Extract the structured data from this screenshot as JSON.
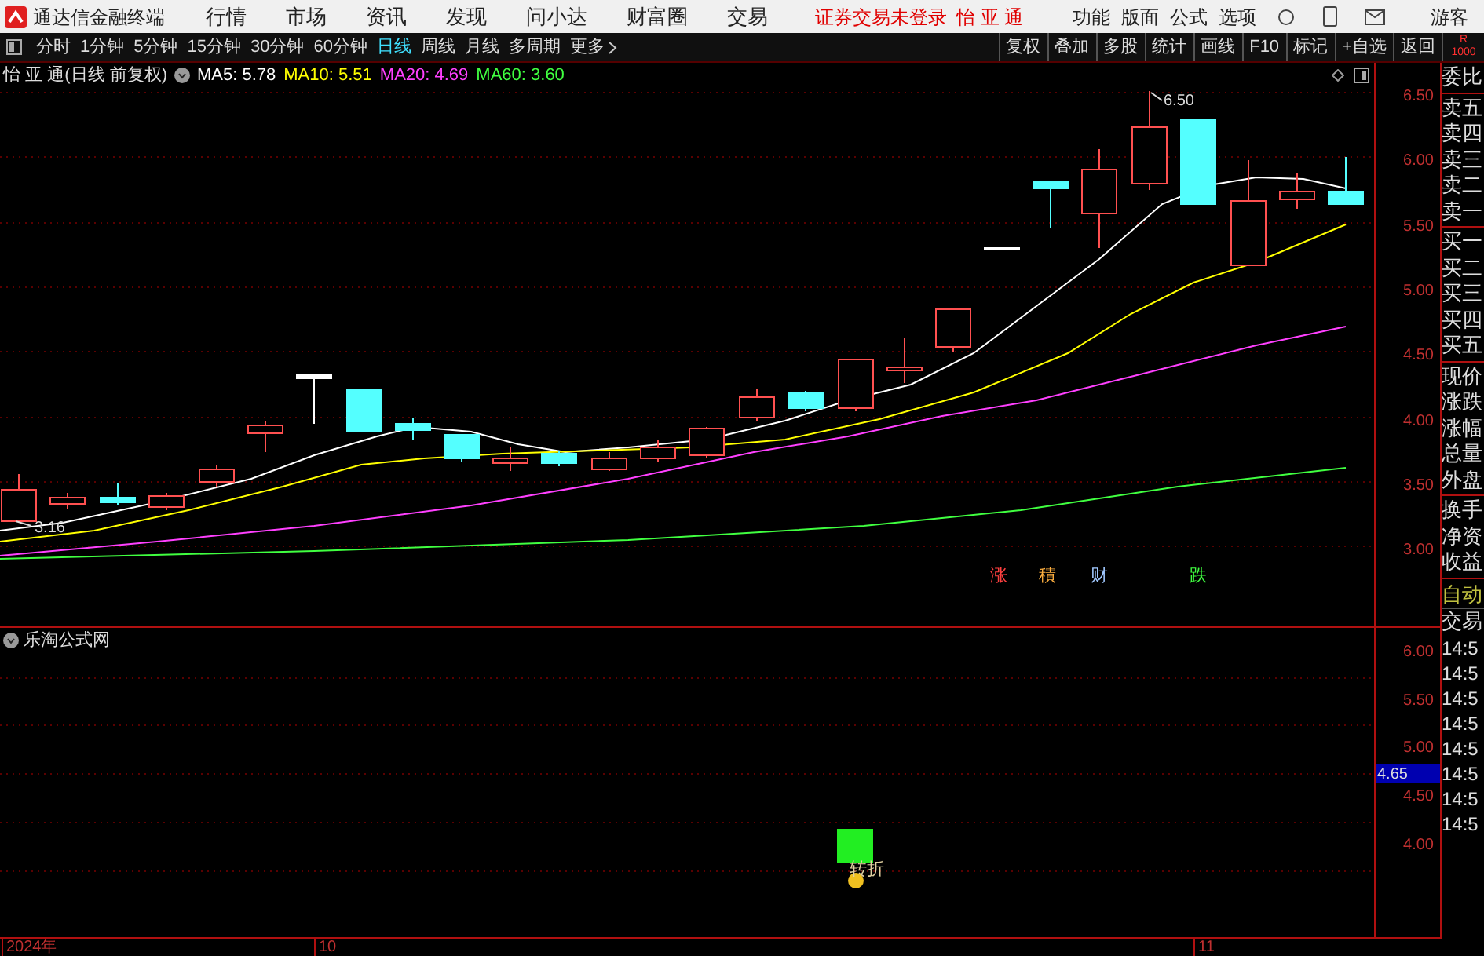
{
  "app": {
    "title": "通达信金融终端"
  },
  "menu": [
    "行情",
    "市场",
    "资讯",
    "发现",
    "问小达",
    "财富圈",
    "交易"
  ],
  "login_status": "证券交易未登录",
  "stock_name": "怡 亚 通",
  "right_menu": [
    "功能",
    "版面",
    "公式",
    "选项"
  ],
  "user": "游客",
  "periods": [
    {
      "label": "分时",
      "selected": false
    },
    {
      "label": "1分钟",
      "selected": false
    },
    {
      "label": "5分钟",
      "selected": false
    },
    {
      "label": "15分钟",
      "selected": false
    },
    {
      "label": "30分钟",
      "selected": false
    },
    {
      "label": "60分钟",
      "selected": false
    },
    {
      "label": "日线",
      "selected": true
    },
    {
      "label": "周线",
      "selected": false
    },
    {
      "label": "月线",
      "selected": false
    },
    {
      "label": "多周期",
      "selected": false
    },
    {
      "label": "更多",
      "selected": false
    }
  ],
  "tools": [
    "复权",
    "叠加",
    "多股",
    "统计",
    "画线",
    "F10",
    "标记",
    "+自选",
    "返回"
  ],
  "corner": [
    "R",
    "1000"
  ],
  "main_chart": {
    "title": "怡 亚 通(日线 前复权)",
    "ma": [
      {
        "label": "MA5: 5.78",
        "color": "#ffffff"
      },
      {
        "label": "MA10: 5.51",
        "color": "#ffff00"
      },
      {
        "label": "MA20: 4.69",
        "color": "#ff40ff"
      },
      {
        "label": "MA60: 3.60",
        "color": "#40ff40"
      }
    ],
    "price_ticks": [
      "6.50",
      "6.00",
      "5.50",
      "5.00",
      "4.50",
      "4.00",
      "3.50",
      "3.00"
    ],
    "annotations": [
      "3.16",
      "6.50"
    ],
    "signals": [
      {
        "text": "涨",
        "color": "#ff4040"
      },
      {
        "text": "積",
        "color": "#ffb040"
      },
      {
        "text": "财",
        "color": "#a0c8ff"
      },
      {
        "text": "跌",
        "color": "#40ff40"
      }
    ]
  },
  "sub_chart": {
    "title": "乐淘公式网",
    "ticks": [
      "6.00",
      "5.50",
      "5.00",
      "4.50",
      "4.00"
    ],
    "current": "4.65",
    "signal": "转折"
  },
  "quote_panel": {
    "groups": [
      [
        "委比"
      ],
      [
        "卖五",
        "卖四",
        "卖三",
        "卖二",
        "卖一"
      ],
      [
        "买一",
        "买二",
        "买三",
        "买四",
        "买五"
      ],
      [
        "现价",
        "涨跌",
        "涨幅",
        "总量",
        "外盘"
      ],
      [
        "换手",
        "净资",
        "收益"
      ]
    ],
    "auto": "自动",
    "trade": "交易",
    "times": [
      "14:5",
      "14:5",
      "14:5",
      "14:5",
      "14:5",
      "14:5",
      "14:5",
      "14:5"
    ]
  },
  "time_axis": [
    "2024年",
    "10",
    "11"
  ]
}
